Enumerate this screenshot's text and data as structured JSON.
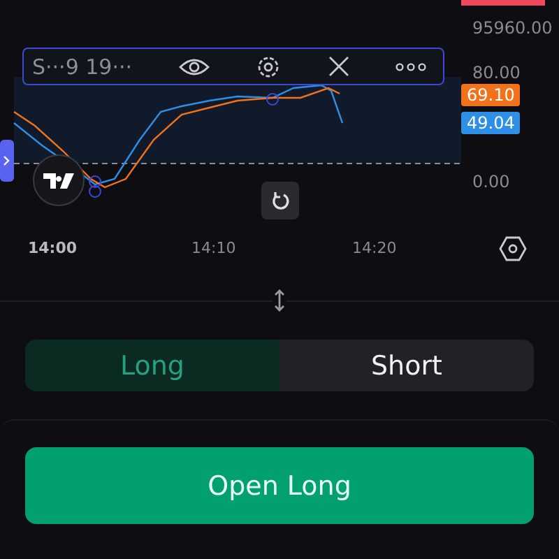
{
  "indicator_toolbar": {
    "title": "S···9 19···"
  },
  "price_axis": [
    {
      "label": "95960.00"
    },
    {
      "label": "80.00"
    },
    {
      "label": "0.00"
    }
  ],
  "value_badges": [
    {
      "label": "69.10",
      "color": "#f2721c"
    },
    {
      "label": "49.04",
      "color": "#2e8fe6"
    }
  ],
  "time_axis": [
    {
      "label": "14:00",
      "selected": true
    },
    {
      "label": "14:10",
      "selected": false
    },
    {
      "label": "14:20",
      "selected": false
    }
  ],
  "side_tabs": [
    {
      "label": "Long",
      "selected": true
    },
    {
      "label": "Short",
      "selected": false
    }
  ],
  "action_button": {
    "label": "Open Long"
  }
}
